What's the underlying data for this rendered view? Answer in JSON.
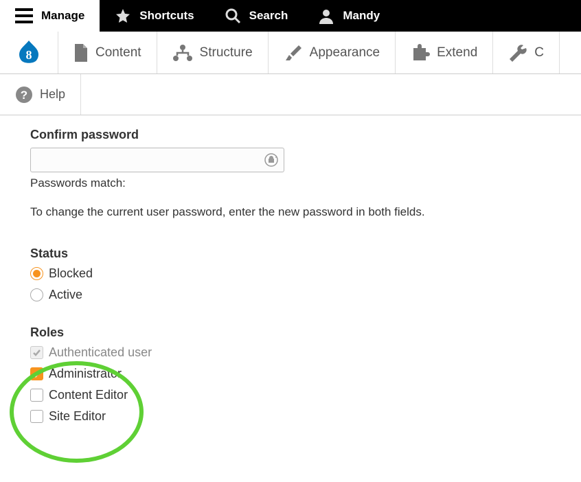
{
  "toolbar": {
    "manage": "Manage",
    "shortcuts": "Shortcuts",
    "search": "Search",
    "user": "Mandy"
  },
  "admin_menu": {
    "content": "Content",
    "structure": "Structure",
    "appearance": "Appearance",
    "extend": "Extend",
    "config_initial": "C"
  },
  "tertiary": {
    "help": "Help"
  },
  "form": {
    "confirm_password_label": "Confirm password",
    "confirm_password_value": "",
    "match_label": "Passwords match:",
    "help": "To change the current user password, enter the new password in both fields."
  },
  "status": {
    "label": "Status",
    "options": [
      {
        "label": "Blocked",
        "checked": true
      },
      {
        "label": "Active",
        "checked": false
      }
    ]
  },
  "roles": {
    "label": "Roles",
    "items": [
      {
        "label": "Authenticated user",
        "checked": true,
        "disabled": true
      },
      {
        "label": "Administrator",
        "checked": true,
        "disabled": false
      },
      {
        "label": "Content Editor",
        "checked": false,
        "disabled": false
      },
      {
        "label": "Site Editor",
        "checked": false,
        "disabled": false
      }
    ]
  }
}
